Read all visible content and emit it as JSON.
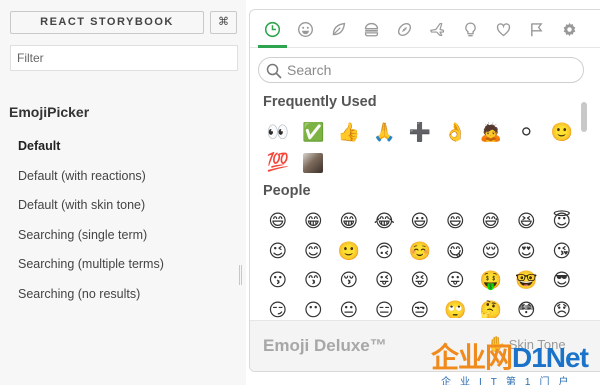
{
  "sidebar": {
    "header_label": "REACT STORYBOOK",
    "shortcut_label": "⌘",
    "filter_placeholder": "Filter",
    "kind": "EmojiPicker",
    "stories": [
      "Default",
      "Default (with reactions)",
      "Default (with skin tone)",
      "Searching (single term)",
      "Searching (multiple terms)",
      "Searching (no results)"
    ],
    "selected_story": "Default"
  },
  "picker": {
    "categories": [
      "recent",
      "people",
      "nature",
      "food",
      "activity",
      "travel",
      "objects",
      "symbols",
      "flags",
      "custom"
    ],
    "active_category": "recent",
    "search_placeholder": "Search",
    "sections": {
      "frequent": {
        "title": "Frequently Used",
        "emojis": [
          "👀",
          "✅",
          "👍",
          "🙏",
          "➕",
          "👌",
          "🙇",
          "⚪",
          "🙂",
          "💯",
          "photo"
        ]
      },
      "people": {
        "title": "People",
        "emojis": [
          "😄",
          "😁",
          "😁",
          "😂",
          "😃",
          "😄",
          "😅",
          "😆",
          "😇",
          "😉",
          "😊",
          "🙂",
          "🙃",
          "☺️",
          "😋",
          "😌",
          "😍",
          "😘",
          "😗",
          "😙",
          "😚",
          "😜",
          "😝",
          "😛",
          "🤑",
          "🤓",
          "😎",
          "😏",
          "😶",
          "😐",
          "😑",
          "😒",
          "🙄",
          "🤔",
          "😳",
          "😞"
        ]
      }
    },
    "footer_title": "Emoji Deluxe™",
    "skin_tone_label": "Skin Tone",
    "skin_tone_icon": "✋"
  },
  "watermark": {
    "logo_cn": "企业网",
    "logo_en": "D1Net",
    "sub": "企业IT第1门户"
  },
  "colors": {
    "accent": "#2ea44f",
    "sidebar_bg": "#f7f7f7",
    "footer_bg": "#f4f4f4"
  }
}
